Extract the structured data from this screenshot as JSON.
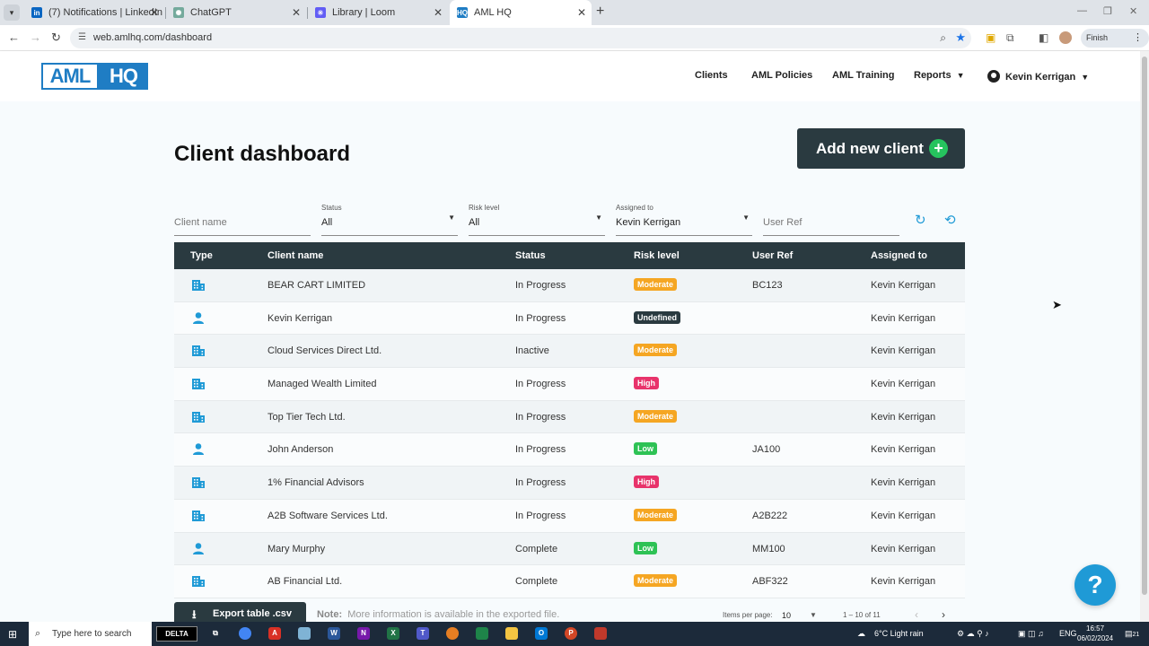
{
  "browser": {
    "tabs": [
      {
        "title": "(7) Notifications | LinkedIn",
        "icon": "linkedin-icon",
        "color": "#0a66c2",
        "glyph": "in"
      },
      {
        "title": "ChatGPT",
        "icon": "chatgpt-icon",
        "color": "#74aa9c",
        "glyph": "✺"
      },
      {
        "title": "Library | Loom",
        "icon": "loom-icon",
        "color": "#625df5",
        "glyph": "✳"
      },
      {
        "title": "AML HQ",
        "icon": "amlhq-icon",
        "color": "#1f7dc4",
        "glyph": "HQ"
      }
    ],
    "url": "web.amlhq.com/dashboard",
    "finish_update": "Finish update"
  },
  "app": {
    "logo_aml": "AML",
    "logo_hq": "HQ",
    "nav": {
      "clients": "Clients",
      "aml_policies": "AML Policies",
      "aml_training": "AML Training",
      "reports": "Reports",
      "user": "Kevin Kerrigan"
    }
  },
  "dashboard": {
    "title": "Client dashboard",
    "add_button": "Add new client",
    "filters": {
      "client_name_placeholder": "Client name",
      "status_label": "Status",
      "status_value": "All",
      "risk_label": "Risk level",
      "risk_value": "All",
      "assigned_label": "Assigned to",
      "assigned_value": "Kevin Kerrigan",
      "user_ref_placeholder": "User Ref"
    },
    "columns": {
      "type": "Type",
      "client_name": "Client name",
      "status": "Status",
      "risk_level": "Risk level",
      "user_ref": "User Ref",
      "assigned_to": "Assigned to"
    },
    "rows": [
      {
        "type": "company",
        "name": "BEAR CART LIMITED",
        "status": "In Progress",
        "risk": "Moderate",
        "ref": "BC123",
        "assigned": "Kevin Kerrigan"
      },
      {
        "type": "person",
        "name": "Kevin Kerrigan",
        "status": "In Progress",
        "risk": "Undefined",
        "ref": "",
        "assigned": "Kevin Kerrigan"
      },
      {
        "type": "company",
        "name": "Cloud Services Direct Ltd.",
        "status": "Inactive",
        "risk": "Moderate",
        "ref": "",
        "assigned": "Kevin Kerrigan"
      },
      {
        "type": "company",
        "name": "Managed Wealth Limited",
        "status": "In Progress",
        "risk": "High",
        "ref": "",
        "assigned": "Kevin Kerrigan"
      },
      {
        "type": "company",
        "name": "Top Tier Tech Ltd.",
        "status": "In Progress",
        "risk": "Moderate",
        "ref": "",
        "assigned": "Kevin Kerrigan"
      },
      {
        "type": "person",
        "name": "John Anderson",
        "status": "In Progress",
        "risk": "Low",
        "ref": "JA100",
        "assigned": "Kevin Kerrigan"
      },
      {
        "type": "company",
        "name": "1% Financial Advisors",
        "status": "In Progress",
        "risk": "High",
        "ref": "",
        "assigned": "Kevin Kerrigan"
      },
      {
        "type": "company",
        "name": "A2B Software Services Ltd.",
        "status": "In Progress",
        "risk": "Moderate",
        "ref": "A2B222",
        "assigned": "Kevin Kerrigan"
      },
      {
        "type": "person",
        "name": "Mary Murphy",
        "status": "Complete",
        "risk": "Low",
        "ref": "MM100",
        "assigned": "Kevin Kerrigan"
      },
      {
        "type": "company",
        "name": "AB Financial Ltd.",
        "status": "Complete",
        "risk": "Moderate",
        "ref": "ABF322",
        "assigned": "Kevin Kerrigan"
      }
    ],
    "risk_colors": {
      "Moderate": "#f5a623",
      "Undefined": "#2a3a40",
      "High": "#e8336b",
      "Low": "#2ec255"
    },
    "export_button": "Export table .csv",
    "note_label": "Note:",
    "note_text": "More information is available in the exported file.",
    "pager": {
      "items_per_page_label": "Items per page:",
      "items_per_page": "10",
      "range": "1 – 10 of 11"
    },
    "help": "?"
  },
  "taskbar": {
    "search_placeholder": "Type here to search",
    "delta": "DELTA",
    "weather": "6°C  Light rain",
    "lang": "ENG",
    "time": "16:57",
    "date": "06/02/2024",
    "notifications": "21"
  }
}
